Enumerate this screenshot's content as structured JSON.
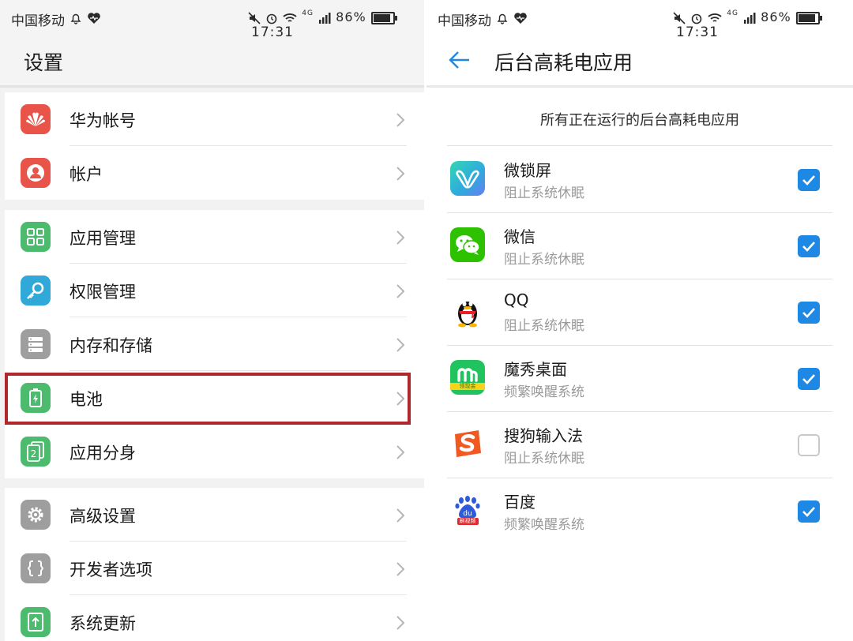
{
  "status_bar": {
    "carrier": "中国移动",
    "network": "4G",
    "battery": "86%",
    "time": "17:31"
  },
  "settings": {
    "title": "设置",
    "groups": [
      {
        "items": [
          {
            "label": "华为帐号",
            "icon": "huawei-logo-icon",
            "color": "#e8534a"
          },
          {
            "label": "帐户",
            "icon": "account-icon",
            "color": "#e8534a"
          }
        ]
      },
      {
        "items": [
          {
            "label": "应用管理",
            "icon": "apps-grid-icon",
            "color": "#4cbb6e"
          },
          {
            "label": "权限管理",
            "icon": "key-icon",
            "color": "#31a9d8"
          },
          {
            "label": "内存和存储",
            "icon": "storage-icon",
            "color": "#9e9e9e"
          },
          {
            "label": "电池",
            "icon": "battery-icon",
            "color": "#4cbb6e",
            "highlighted": true
          },
          {
            "label": "应用分身",
            "icon": "app-twin-icon",
            "color": "#4cbb6e"
          }
        ]
      },
      {
        "items": [
          {
            "label": "高级设置",
            "icon": "gear-icon",
            "color": "#9e9e9e"
          },
          {
            "label": "开发者选项",
            "icon": "braces-icon",
            "color": "#9e9e9e"
          },
          {
            "label": "系统更新",
            "icon": "update-icon",
            "color": "#4cbb6e"
          }
        ]
      }
    ]
  },
  "power_apps": {
    "title": "后台高耗电应用",
    "caption": "所有正在运行的后台高耗电应用",
    "apps": [
      {
        "name": "微锁屏",
        "status": "阻止系统休眠",
        "checked": true,
        "icon": "wei-lock-screen-icon"
      },
      {
        "name": "微信",
        "status": "阻止系统休眠",
        "checked": true,
        "icon": "wechat-icon"
      },
      {
        "name": "QQ",
        "status": "阻止系统休眠",
        "checked": true,
        "icon": "qq-penguin-icon"
      },
      {
        "name": "魔秀桌面",
        "status": "频繁唤醒系统",
        "checked": true,
        "icon": "moxiu-icon",
        "icon_caption": "领现金"
      },
      {
        "name": "搜狗输入法",
        "status": "阻止系统休眠",
        "checked": false,
        "icon": "sogou-icon"
      },
      {
        "name": "百度",
        "status": "频繁唤醒系统",
        "checked": true,
        "icon": "baidu-icon",
        "icon_caption": "刷视频"
      }
    ]
  }
}
